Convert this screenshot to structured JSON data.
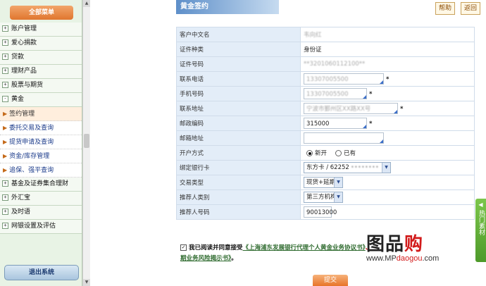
{
  "sidebar": {
    "title": "全部菜单",
    "items": [
      {
        "label": "账户管理",
        "expand": "+"
      },
      {
        "label": "爱心捐款",
        "expand": "+"
      },
      {
        "label": "贷款",
        "expand": "+"
      },
      {
        "label": "理财产品",
        "expand": "+"
      },
      {
        "label": "股票与期货",
        "expand": "+"
      },
      {
        "label": "黄金",
        "expand": "-"
      }
    ],
    "subitems": [
      {
        "label": "签约管理"
      },
      {
        "label": "委托交易及查询"
      },
      {
        "label": "提货申请及查询"
      },
      {
        "label": "资金/库存管理"
      },
      {
        "label": "追保、强平查询"
      }
    ],
    "items2": [
      {
        "label": "基金及证券集合理财",
        "expand": "+"
      },
      {
        "label": "外汇宝",
        "expand": "+"
      },
      {
        "label": "及时语",
        "expand": "+"
      },
      {
        "label": "网银设置及评估",
        "expand": "+"
      }
    ],
    "logout_label": "退出系统"
  },
  "header": {
    "title": "黄金签约",
    "help_label": "帮助",
    "back_label": "返回"
  },
  "form": {
    "rows": [
      {
        "label": "客户中文名",
        "value": "韦向红"
      },
      {
        "label": "证件种类",
        "value": "身份证"
      },
      {
        "label": "证件号码",
        "value": "**3201060112100**"
      },
      {
        "label": "联系电话",
        "value": "13307005500"
      },
      {
        "label": "手机号码",
        "value": "13307005500"
      },
      {
        "label": "联系地址",
        "value": "宁波市鄞州区XX路XX号"
      },
      {
        "label": "邮政编码",
        "value": "315000"
      },
      {
        "label": "邮箱地址",
        "value": ""
      },
      {
        "label": "开户方式",
        "opt1": "新开",
        "opt2": "已有"
      },
      {
        "label": "绑定银行卡",
        "value": "东方卡 / 62252"
      },
      {
        "label": "交易类型",
        "value": "现货+延期"
      },
      {
        "label": "推荐人类别",
        "value": "第三方机构"
      },
      {
        "label": "推荐人号码",
        "value": "90013000"
      }
    ],
    "required_mark": "*"
  },
  "agreement": {
    "prefix": "我已阅读并同意接受",
    "link1": "《上海浦东发展银行代理个人黄金业务协议书》",
    "sep": "、",
    "link2": "期业务风险揭示书》",
    "suffix": "。"
  },
  "submit_label": "提交",
  "right_tab": {
    "label": "热门素材"
  },
  "watermark": {
    "logo_a": "图品",
    "logo_b": "购",
    "url_a": "www.MP",
    "url_b": "daogou",
    "url_c": ".com"
  }
}
